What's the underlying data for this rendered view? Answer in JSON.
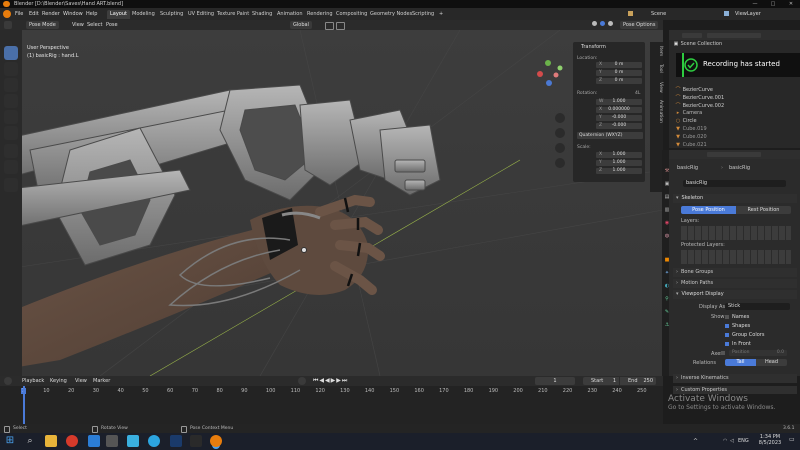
{
  "window": {
    "title": "Blender [D:\\Blender\\Saves\\Hand ART.blend]",
    "controls": [
      "—",
      "□",
      "✕"
    ]
  },
  "menu": {
    "items": [
      "File",
      "Edit",
      "Render",
      "Window",
      "Help"
    ],
    "workspaces": [
      "Layout",
      "Modeling",
      "Sculpting",
      "UV Editing",
      "Texture Paint",
      "Shading",
      "Animation",
      "Rendering",
      "Compositing",
      "Geometry Nodes",
      "Scripting"
    ],
    "active_workspace": "Layout",
    "plus": "+",
    "scene_label": "Scene",
    "viewlayer_label": "ViewLayer"
  },
  "viewport_header": {
    "mode": "Pose Mode",
    "menus": [
      "View",
      "Select",
      "Pose"
    ],
    "orientation": "Global",
    "pose_options": "Pose Options"
  },
  "viewport": {
    "view_name": "User Perspective",
    "object_info": "(1) basicRig : hand.L"
  },
  "npanel": {
    "header": "Transform",
    "location_label": "Location:",
    "loc": [
      {
        "axis": "X",
        "value": "0 m"
      },
      {
        "axis": "Y",
        "value": "0 m"
      },
      {
        "axis": "Z",
        "value": "0 m"
      }
    ],
    "rotation_label": "Rotation:",
    "rotation_mode_tag": "4L",
    "rot": [
      {
        "axis": "W",
        "value": "1.000"
      },
      {
        "axis": "X",
        "value": "0.000000"
      },
      {
        "axis": "Y",
        "value": "-0.000"
      },
      {
        "axis": "Z",
        "value": "-0.000"
      }
    ],
    "rotation_mode": "Quaternion (WXYZ)",
    "scale_label": "Scale:",
    "scale": [
      {
        "axis": "X",
        "value": "1.000"
      },
      {
        "axis": "Y",
        "value": "1.000"
      },
      {
        "axis": "Z",
        "value": "1.000"
      }
    ],
    "tabs": [
      "Item",
      "Tool",
      "View",
      "Animation"
    ]
  },
  "outliner": {
    "header": "Scene Collection",
    "items": [
      {
        "name": "BezierCurve",
        "icon": "curve-icon"
      },
      {
        "name": "BezierCurve.001",
        "icon": "curve-icon"
      },
      {
        "name": "BezierCurve.002",
        "icon": "curve-icon"
      },
      {
        "name": "Camera",
        "icon": "camera-icon"
      },
      {
        "name": "Circle",
        "icon": "curve-icon"
      },
      {
        "name": "Cube.019",
        "icon": "mesh-icon"
      },
      {
        "name": "Cube.020",
        "icon": "mesh-icon"
      },
      {
        "name": "Cube.021",
        "icon": "mesh-icon"
      }
    ]
  },
  "recording": {
    "text": "Recording has started",
    "accent": "#2ecc40"
  },
  "properties": {
    "breadcrumb_object": "basicRig",
    "breadcrumb_data": "basicRig",
    "data_name": "basicRig",
    "skeleton_header": "Skeleton",
    "pose_position": "Pose Position",
    "rest_position": "Rest Position",
    "layers_label": "Layers:",
    "protected_layers_label": "Protected Layers:",
    "sections": [
      "Bone Groups",
      "Motion Paths",
      "Viewport Display",
      "Inverse Kinematics",
      "Custom Properties"
    ],
    "display_as_label": "Display As",
    "display_as_value": "Stick",
    "show_label": "Show",
    "show_items": [
      {
        "label": "Names",
        "checked": false
      },
      {
        "label": "Shapes",
        "checked": true
      },
      {
        "label": "Group Colors",
        "checked": true
      },
      {
        "label": "In Front",
        "checked": true
      }
    ],
    "axes_label": "Axes",
    "axes_position_label": "Position",
    "axes_position_value": "0.0",
    "relations_label": "Relations",
    "relations_tail": "Tail",
    "relations_head": "Head"
  },
  "timeline": {
    "menus": [
      "Playback",
      "Keying",
      "View",
      "Marker"
    ],
    "current_frame": "1",
    "start_label": "Start",
    "start": "1",
    "end_label": "End",
    "end": "250",
    "ticks": [
      "1",
      "10",
      "20",
      "30",
      "40",
      "50",
      "60",
      "70",
      "80",
      "90",
      "100",
      "110",
      "120",
      "130",
      "140",
      "150",
      "160",
      "170",
      "180",
      "190",
      "200",
      "210",
      "220",
      "230",
      "240",
      "250"
    ]
  },
  "statusbar": {
    "select": "Select",
    "rotate": "Rotate View",
    "menu": "Pose Context Menu",
    "version": "3.6.1"
  },
  "watermark": {
    "title": "Activate Windows",
    "subtitle": "Go to Settings to activate Windows."
  },
  "taskbar": {
    "lang": "ENG",
    "time": "1:34 PM",
    "date": "8/5/2023"
  },
  "colors": {
    "accent_blue": "#4a7ad8",
    "active_tool": "#4a6fa8",
    "bone_orange": "#d28a3a"
  }
}
